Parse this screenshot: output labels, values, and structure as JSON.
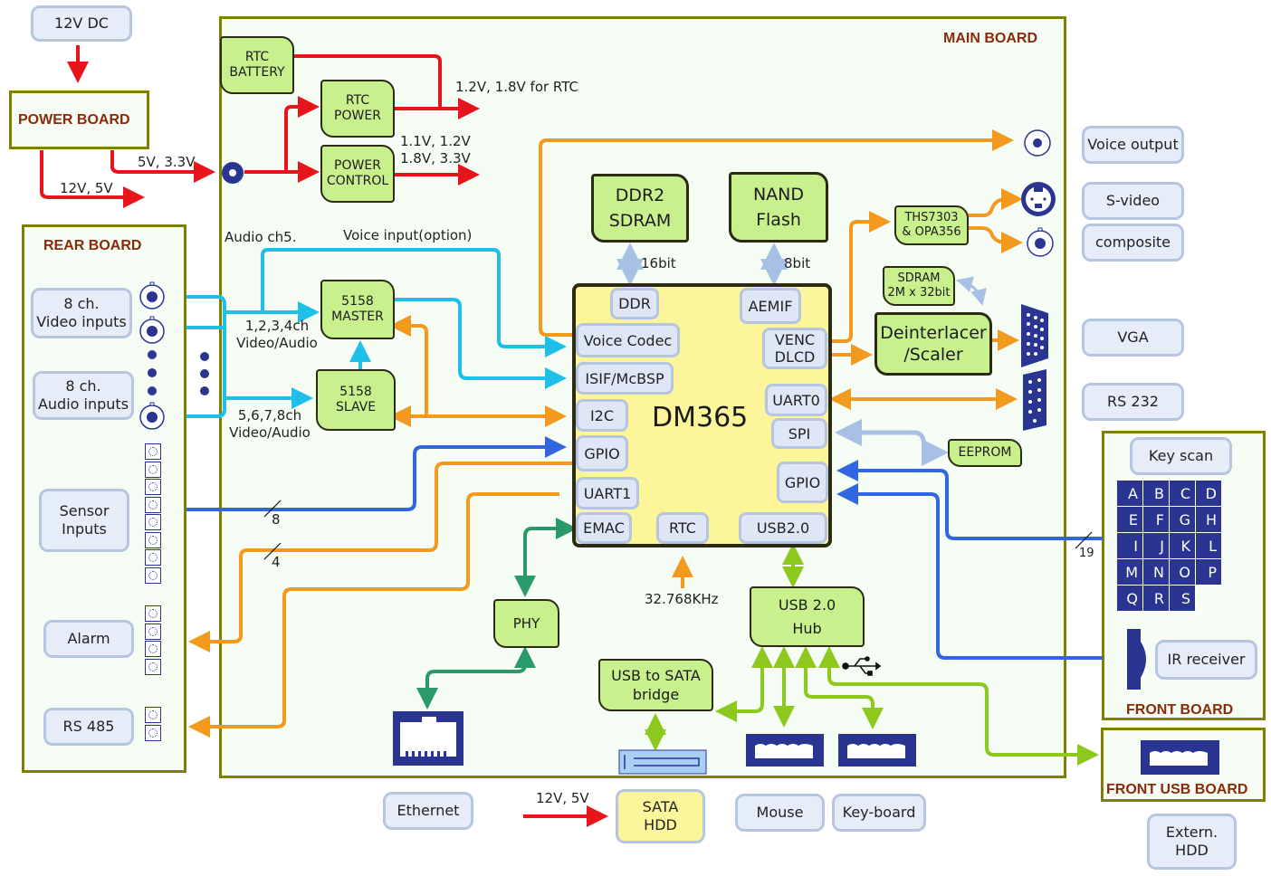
{
  "colors": {
    "power": "#e8141c",
    "video": "#1ec0e8",
    "orange": "#f39a1e",
    "gpio_blue": "#3166e0",
    "light_blue": "#a8c0e4",
    "ethernet_green": "#2a9a6a",
    "usb_green": "#8cc81e",
    "board_border": "#7f7f00",
    "board_title": "#8b2a0a",
    "chip_fill": "#c8f08c",
    "dm365_fill": "#fdf59a",
    "connector_navy": "#2a3592"
  },
  "external": {
    "dc_input": "12V DC",
    "power_board": "POWER BOARD",
    "power_out_main": "5V, 3.3V",
    "power_out_aux": "12V, 5V",
    "voice_output": "Voice output",
    "s_video": "S-video",
    "composite": "composite",
    "vga": "VGA",
    "rs232": "RS  232",
    "ethernet": "Ethernet",
    "sata_power": "12V, 5V",
    "sata_hdd": "SATA\nHDD",
    "mouse": "Mouse",
    "keyboard": "Key-board",
    "extern_hdd": "Extern.\nHDD"
  },
  "main_board": {
    "title": "MAIN BOARD",
    "rtc_battery": "RTC\nBATTERY",
    "rtc_power": "RTC\nPOWER",
    "power_control": "POWER\nCONTROL",
    "rtc_voltage": "1.2V, 1.8V for RTC",
    "core_voltages": "1.1V, 1.2V\n1.8V, 3.3V",
    "ddr2": "DDR2\nSDRAM",
    "nand": "NAND\nFlash",
    "ddr_bus": "16bit",
    "nand_bus": "8bit",
    "audio_ch5": "Audio ch5.",
    "voice_input": "Voice input(option)",
    "master": "5158\nMASTER",
    "slave": "5158\nSLAVE",
    "ch_1_4": "1,2,3,4ch\nVideo/Audio",
    "ch_5_8": "5,6,7,8ch\nVideo/Audio",
    "ths": "THS7303\n& OPA356",
    "sdram_small": "SDRAM\n2M x 32bit",
    "deinterlacer": "Deinterlacer\n/Scaler",
    "eeprom": "EEPROM",
    "sensor_bus": "8",
    "alarm_bus": "4",
    "key_bus": "19",
    "crystal": "32.768KHz",
    "phy": "PHY",
    "usb_hub": "USB 2.0\nHub",
    "usb_sata": "USB to SATA\nbridge",
    "usb_symbol": "usb-icon"
  },
  "dm365": {
    "name": "DM365",
    "ports": {
      "ddr": "DDR",
      "aemif": "AEMIF",
      "voice_codec": "Voice Codec",
      "venc": "VENC\nDLCD",
      "isif": "ISIF/McBSP",
      "uart0": "UART0",
      "i2c": "I2C",
      "spi": "SPI",
      "gpio_left": "GPIO",
      "gpio_right": "GPIO",
      "uart1": "UART1",
      "emac": "EMAC",
      "rtc": "RTC",
      "usb": "USB2.0"
    }
  },
  "rear_board": {
    "title": "REAR BOARD",
    "video_inputs": "8 ch.\nVideo inputs",
    "audio_inputs": "8 ch.\nAudio inputs",
    "sensor_inputs": "Sensor\nInputs",
    "alarm": "Alarm",
    "rs485": "RS  485"
  },
  "front_board": {
    "title": "FRONT BOARD",
    "key_scan": "Key scan",
    "keys": [
      "A",
      "B",
      "C",
      "D",
      "E",
      "F",
      "G",
      "H",
      "I",
      "J",
      "K",
      "L",
      "M",
      "N",
      "O",
      "P",
      "Q",
      "R",
      "S"
    ],
    "ir_receiver": "IR receiver"
  },
  "front_usb_board": {
    "title": "FRONT  USB BOARD"
  }
}
